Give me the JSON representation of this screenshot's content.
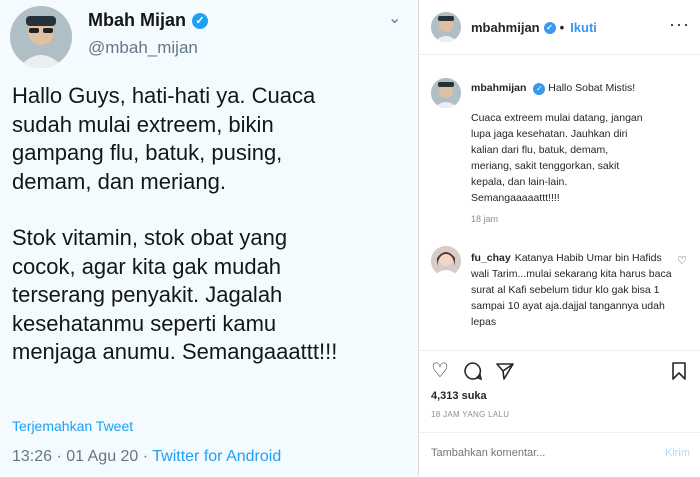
{
  "twitter": {
    "name": "Mbah Mijan",
    "handle": "@mbah_mijan",
    "body_p1": "Hallo Guys, hati-hati ya. Cuaca\nsudah mulai extreem, bikin\ngampang flu, batuk, pusing,\ndemam, dan meriang.",
    "body_p2": "Stok vitamin, stok obat yang\ncocok, agar kita gak mudah\nterserang penyakit. Jagalah\nkesehatanmu seperti kamu\nmenjaga anumu. Semangaaattt!!!",
    "translate": "Terjemahkan Tweet",
    "time": "13:26 · 01 Agu 20 · ",
    "source": "Twitter for Android",
    "accent": "#1da1f2"
  },
  "instagram": {
    "username": "mbahmijan",
    "follow": "Ikuti",
    "caption_title": "Hallo Sobat Mistis!",
    "caption_text": "Cuaca extreem mulai datang, jangan\nlupa jaga kesehatan. Jauhkan diri\nkalian dari flu, batuk, demam,\nmeriang, sakit tenggorkan, sakit\nkepala, dan lain-lain.\nSemangaaaaattt!!!!",
    "caption_time": "18 jam",
    "comment_user": "fu_chay",
    "comment_text": "Katanya Habib Umar bin Hafids wali Tarim...mulai sekarang kita harus baca surat al Kafi sebelum tidur klo gak bisa 1 sampai 10 ayat aja.dajjal tangannya udah lepas",
    "likes": "4,313 suka",
    "post_time": "18 JAM YANG LALU",
    "comment_placeholder": "Tambahkan komentar...",
    "post_label": "Kirim",
    "accent": "#3897f0"
  }
}
